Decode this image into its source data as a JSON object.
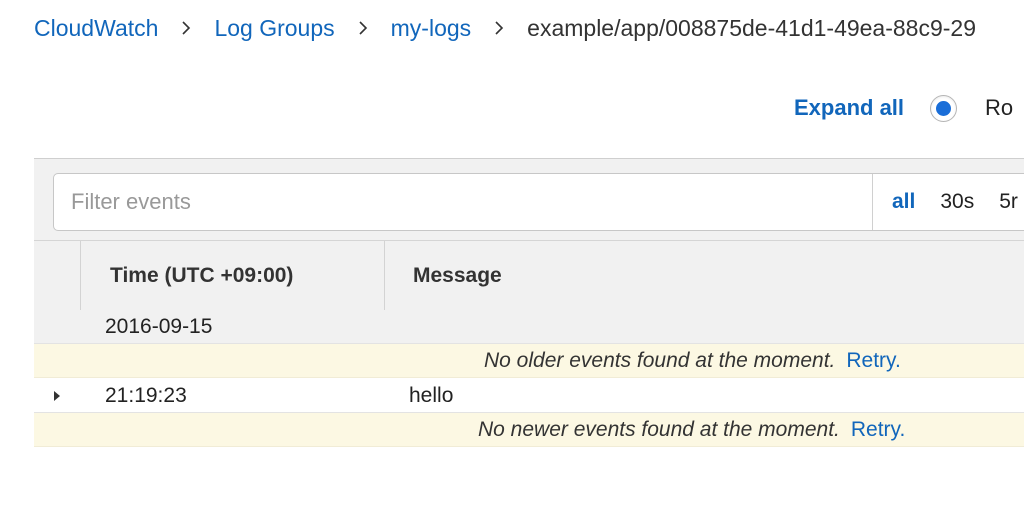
{
  "breadcrumb": {
    "items": [
      "CloudWatch",
      "Log Groups",
      "my-logs"
    ],
    "current": "example/app/008875de-41d1-49ea-88c9-29"
  },
  "controls": {
    "expand_all": "Expand all",
    "radio_label": "Ro",
    "radio_checked": true
  },
  "filter": {
    "placeholder": "Filter events",
    "value": "",
    "ranges": [
      "all",
      "30s",
      "5r"
    ],
    "active_range": "all"
  },
  "table": {
    "columns": [
      "Time (UTC +09:00)",
      "Message"
    ],
    "date_group": "2016-09-15",
    "events": [
      {
        "time": "21:19:23",
        "message": "hello"
      }
    ],
    "older_notice": "No older events found at the moment.",
    "newer_notice": "No newer events found at the moment.",
    "retry_label": "Retry."
  },
  "colors": {
    "link": "#1166bb",
    "panel_bg": "#f1f1f1",
    "notice_bg": "#fcf8e3",
    "radio_dot": "#1a6ed8"
  },
  "icons": [
    "chevron-right-icon",
    "caret-right-icon"
  ]
}
